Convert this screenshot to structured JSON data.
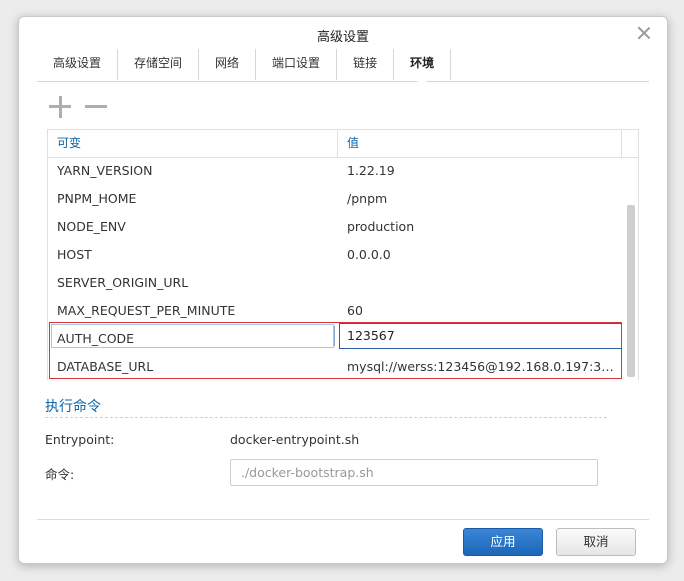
{
  "dialog": {
    "title": "高级设置"
  },
  "tabs": [
    {
      "label": "高级设置"
    },
    {
      "label": "存储空间"
    },
    {
      "label": "网络"
    },
    {
      "label": "端口设置"
    },
    {
      "label": "链接"
    },
    {
      "label": "环境"
    }
  ],
  "env_table": {
    "headers": {
      "variable": "可变",
      "value": "值"
    },
    "rows": [
      {
        "key": "YARN_VERSION",
        "value": "1.22.19"
      },
      {
        "key": "PNPM_HOME",
        "value": "/pnpm"
      },
      {
        "key": "NODE_ENV",
        "value": "production"
      },
      {
        "key": "HOST",
        "value": "0.0.0.0"
      },
      {
        "key": "SERVER_ORIGIN_URL",
        "value": ""
      },
      {
        "key": "MAX_REQUEST_PER_MINUTE",
        "value": "60"
      },
      {
        "key": "AUTH_CODE",
        "value": "123567"
      },
      {
        "key": "DATABASE_URL",
        "value": "mysql://werss:123456@192.168.0.197:33..."
      }
    ]
  },
  "exec": {
    "title": "执行命令",
    "entrypoint_label": "Entrypoint:",
    "entrypoint_value": "docker-entrypoint.sh",
    "command_label": "命令:",
    "command_placeholder": "./docker-bootstrap.sh"
  },
  "footer": {
    "apply_label": "应用",
    "cancel_label": "取消"
  },
  "colors": {
    "accent": "#0c64a9",
    "highlight": "#d9353b",
    "primary_button": "#1c66b8"
  }
}
